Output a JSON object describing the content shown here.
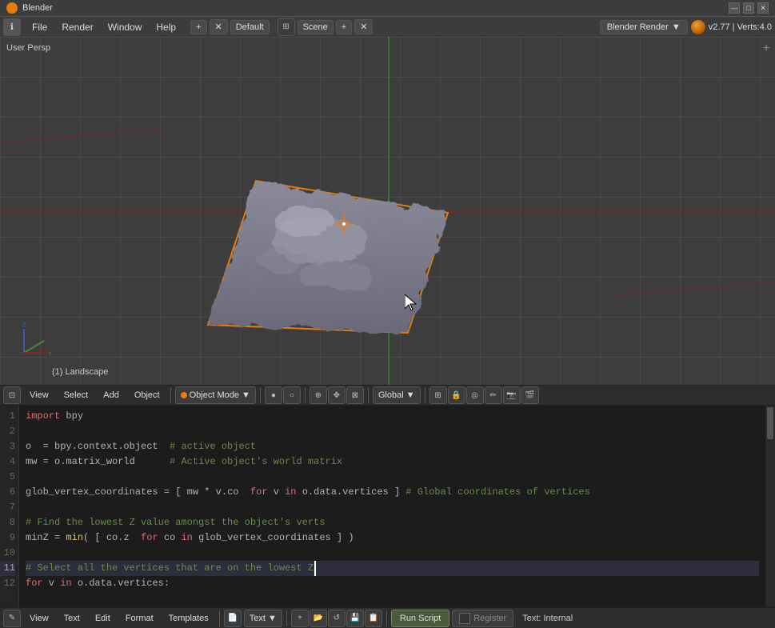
{
  "titlebar": {
    "title": "Blender",
    "controls": [
      "—",
      "□",
      "✕"
    ]
  },
  "menubar": {
    "items": [
      "File",
      "Render",
      "Window",
      "Help"
    ],
    "layout": "Default",
    "scene": "Scene",
    "render_engine": "Blender Render",
    "version": "v2.77 | Verts:4.0"
  },
  "viewport": {
    "label": "User Persp",
    "object_name": "(1) Landscape",
    "mode_label": "Object Mode",
    "global_label": "Global",
    "toolbar_items": [
      "View",
      "Select",
      "Add",
      "Object"
    ]
  },
  "code_editor": {
    "lines": [
      {
        "n": 1,
        "text": "import bpy",
        "tokens": [
          {
            "t": "import",
            "c": "kw"
          },
          {
            "t": " bpy",
            "c": "id"
          }
        ]
      },
      {
        "n": 2,
        "text": "",
        "tokens": []
      },
      {
        "n": 3,
        "text": "o  = bpy.context.object  # active object",
        "tokens": [
          {
            "t": "o",
            "c": "id"
          },
          {
            "t": "  = ",
            "c": "plain"
          },
          {
            "t": "bpy.context.object",
            "c": "id"
          },
          {
            "t": "  # active object",
            "c": "cm"
          }
        ]
      },
      {
        "n": 4,
        "text": "mw = o.matrix_world      # Active object's world matrix",
        "tokens": [
          {
            "t": "mw",
            "c": "id"
          },
          {
            "t": " = ",
            "c": "plain"
          },
          {
            "t": "o.matrix_world",
            "c": "id"
          },
          {
            "t": "      # Active object's world matrix",
            "c": "cm"
          }
        ]
      },
      {
        "n": 5,
        "text": "",
        "tokens": []
      },
      {
        "n": 6,
        "text": "glob_vertex_coordinates = [ mw * v.co  for v in o.data.vertices ] # Global coordinates of vertices",
        "tokens": [
          {
            "t": "glob_vertex_coordinates",
            "c": "id"
          },
          {
            "t": " = [ ",
            "c": "plain"
          },
          {
            "t": "mw",
            "c": "id"
          },
          {
            "t": " * ",
            "c": "plain"
          },
          {
            "t": "v.co",
            "c": "id"
          },
          {
            "t": "  ",
            "c": "plain"
          },
          {
            "t": "for",
            "c": "kw"
          },
          {
            "t": " v ",
            "c": "id"
          },
          {
            "t": "in",
            "c": "kw"
          },
          {
            "t": " o.data.vertices ] ",
            "c": "id"
          },
          {
            "t": "# Global coordinates of vertices",
            "c": "cm"
          }
        ]
      },
      {
        "n": 7,
        "text": "",
        "tokens": []
      },
      {
        "n": 8,
        "text": "# Find the lowest Z value amongst the object's verts",
        "tokens": [
          {
            "t": "# Find the lowest Z value amongst the object's verts",
            "c": "cm"
          }
        ]
      },
      {
        "n": 9,
        "text": "minZ = min( [ co.z  for co in glob_vertex_coordinates ] )",
        "tokens": [
          {
            "t": "minZ",
            "c": "id"
          },
          {
            "t": " = ",
            "c": "plain"
          },
          {
            "t": "min",
            "c": "sc"
          },
          {
            "t": "( [ ",
            "c": "plain"
          },
          {
            "t": "co.z",
            "c": "id"
          },
          {
            "t": "  ",
            "c": "plain"
          },
          {
            "t": "for",
            "c": "kw"
          },
          {
            "t": " co ",
            "c": "id"
          },
          {
            "t": "in",
            "c": "kw"
          },
          {
            "t": " glob_vertex_coordinates ] )",
            "c": "id"
          }
        ]
      },
      {
        "n": 10,
        "text": "",
        "tokens": []
      },
      {
        "n": 11,
        "text": "# Select all the vertices that are on the lowest Z",
        "tokens": [
          {
            "t": "# Select all the vertices that are on the lowest Z",
            "c": "cm"
          }
        ],
        "highlighted": true
      },
      {
        "n": 12,
        "text": "for v in o.data.vertices:",
        "tokens": [
          {
            "t": "for",
            "c": "kw"
          },
          {
            "t": " v ",
            "c": "id"
          },
          {
            "t": "in",
            "c": "kw"
          },
          {
            "t": " o.data.vertices:",
            "c": "id"
          }
        ]
      }
    ]
  },
  "code_toolbar": {
    "items": [
      "View",
      "Text",
      "Edit",
      "Format",
      "Templates"
    ],
    "file_section": "Text",
    "run_script": "Run Script",
    "register": "Register",
    "text_name": "Text: Internal"
  }
}
